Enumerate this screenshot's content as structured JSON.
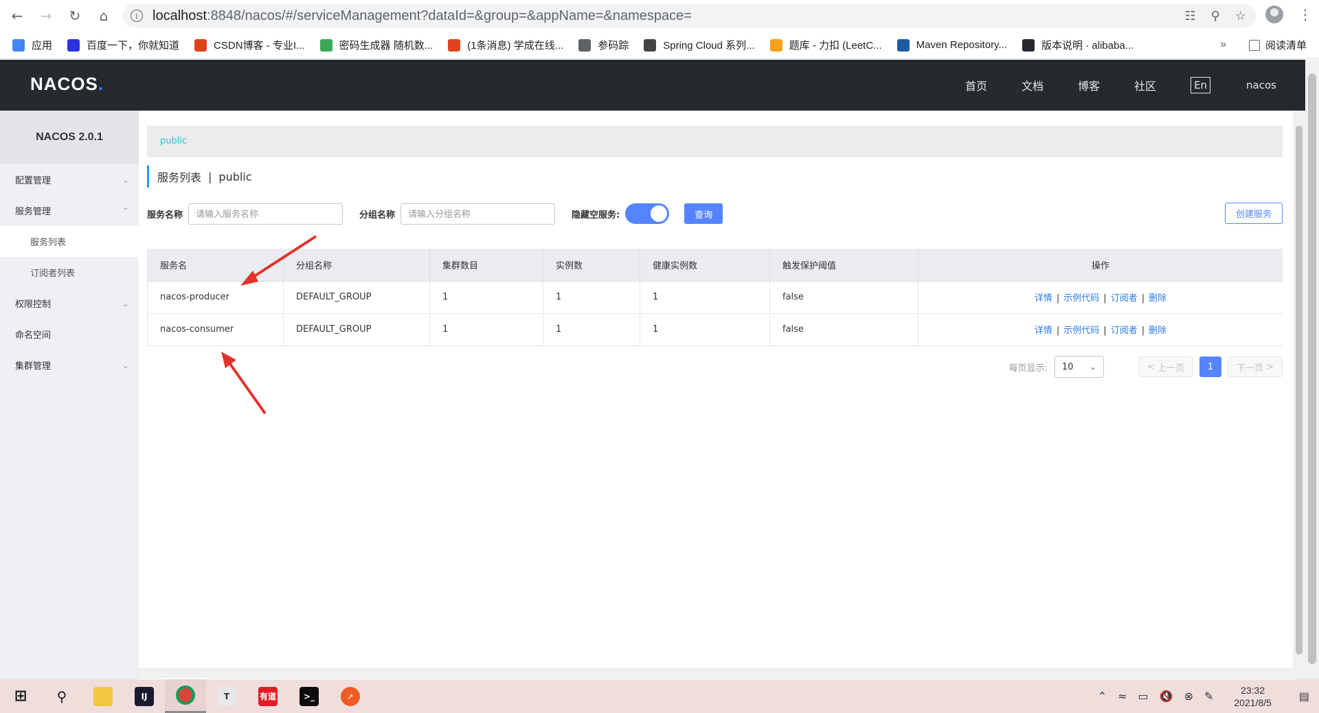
{
  "browser": {
    "url_host": "localhost",
    "url_rest": ":8848/nacos/#/serviceManagement?dataId=&group=&appName=&namespace=",
    "bookmarks": [
      {
        "label": "应用",
        "icon": "apps-grid-icon",
        "color": "#4285f4"
      },
      {
        "label": "百度一下，你就知道",
        "icon": "baidu-paw-icon",
        "color": "#2932e1"
      },
      {
        "label": "CSDN博客 - 专业I...",
        "icon": "csdn-icon",
        "color": "#e0421b"
      },
      {
        "label": "密码生成器 随机数...",
        "icon": "password-gen-icon",
        "color": "#3aa757"
      },
      {
        "label": "(1条消息) 学成在线...",
        "icon": "csdn-icon",
        "color": "#e0421b"
      },
      {
        "label": "参码踪",
        "icon": "globe-icon",
        "color": "#5f6368"
      },
      {
        "label": "Spring Cloud 系列...",
        "icon": "bottle-icon",
        "color": "#444444"
      },
      {
        "label": "题库 - 力扣 (LeetC...",
        "icon": "leetcode-icon",
        "color": "#f89f1b"
      },
      {
        "label": "Maven Repository...",
        "icon": "maven-icon",
        "color": "#1f5aa6"
      },
      {
        "label": "版本说明 · alibaba...",
        "icon": "github-icon",
        "color": "#24292e"
      }
    ],
    "overflow": "»",
    "reading_list": "阅读清单"
  },
  "header": {
    "logo": "NACOS",
    "nav": [
      "首页",
      "文档",
      "博客",
      "社区"
    ],
    "lang": "En",
    "user": "nacos"
  },
  "sidebar": {
    "brand": "NACOS 2.0.1",
    "items": [
      {
        "label": "配置管理",
        "chevron": "down"
      },
      {
        "label": "服务管理",
        "chevron": "up"
      },
      {
        "label": "服务列表",
        "sub": true,
        "active": true
      },
      {
        "label": "订阅者列表",
        "sub": true
      },
      {
        "label": "权限控制",
        "chevron": "down"
      },
      {
        "label": "命名空间"
      },
      {
        "label": "集群管理",
        "chevron": "down"
      }
    ]
  },
  "main": {
    "namespace_tab": "public",
    "title": "服务列表",
    "title_sep": "|",
    "title_ns": "public",
    "filters": {
      "service_label": "服务名称",
      "service_placeholder": "请输入服务名称",
      "group_label": "分组名称",
      "group_placeholder": "请输入分组名称",
      "hide_empty_label": "隐藏空服务:",
      "hide_empty_on": true,
      "query_button": "查询",
      "create_button": "创建服务"
    },
    "table": {
      "columns": [
        "服务名",
        "分组名称",
        "集群数目",
        "实例数",
        "健康实例数",
        "触发保护阈值",
        "操作"
      ],
      "rows": [
        [
          "nacos-producer",
          "DEFAULT_GROUP",
          "1",
          "1",
          "1",
          "false"
        ],
        [
          "nacos-consumer",
          "DEFAULT_GROUP",
          "1",
          "1",
          "1",
          "false"
        ]
      ],
      "actions": [
        "详情",
        "示例代码",
        "订阅者",
        "删除"
      ]
    },
    "pagination": {
      "per_page_label": "每页显示:",
      "per_page": "10",
      "prev": "上一页",
      "current": "1",
      "next": "下一页"
    }
  },
  "taskbar": {
    "time": "23:32",
    "date": "2021/8/5"
  },
  "colors": {
    "accent": "#5584ff",
    "header_bg": "#252a2f",
    "link": "#2c7be5",
    "crumb": "#2ebbd2",
    "arrow": "#e5312b"
  }
}
